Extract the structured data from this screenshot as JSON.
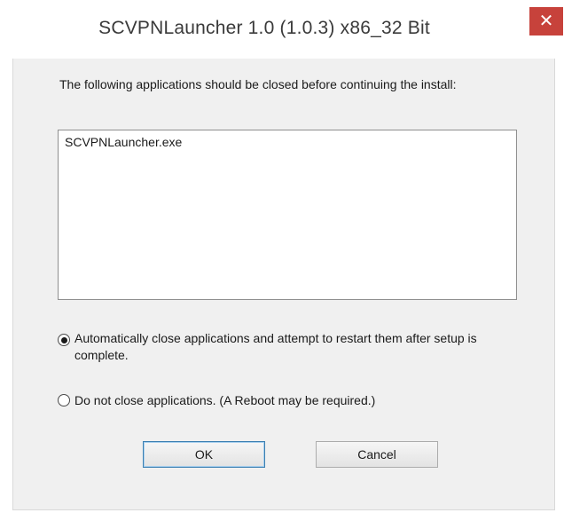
{
  "window": {
    "title": "SCVPNLauncher 1.0 (1.0.3) x86_32 Bit",
    "close_glyph": "✕"
  },
  "dialog": {
    "message": "The following applications should be closed before continuing the install:",
    "applications": [
      "SCVPNLauncher.exe"
    ],
    "options": [
      {
        "label": "Automatically close applications and attempt to restart them after setup is complete.",
        "selected": true
      },
      {
        "label": "Do not close applications. (A Reboot may be required.)",
        "selected": false
      }
    ],
    "ok_label": "OK",
    "cancel_label": "Cancel"
  },
  "colors": {
    "close_button": "#c7423b",
    "dialog_background": "#f0f0f0",
    "default_button_border": "#3c7fb1"
  },
  "icons": {
    "close": "close-icon"
  }
}
